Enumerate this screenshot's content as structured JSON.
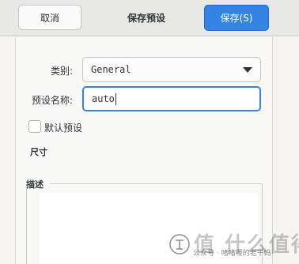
{
  "header": {
    "cancel_label": "取消",
    "title": "保存预设",
    "save_label": "保存(S)"
  },
  "form": {
    "category_label": "类别:",
    "category_value": "General",
    "name_label": "预设名称:",
    "name_value": "auto",
    "default_checkbox_label": "默认预设",
    "default_checked": false,
    "size_heading": "尺寸",
    "description_heading": "描述",
    "description_value": ""
  },
  "watermark": {
    "big_text": "值 什么值得买",
    "small_text": "公众号 · 啫啫喱的老干妈"
  },
  "colors": {
    "accent": "#3584e4",
    "header_bg": "#e8e8e7",
    "panel_bg": "#f8f8f7"
  }
}
